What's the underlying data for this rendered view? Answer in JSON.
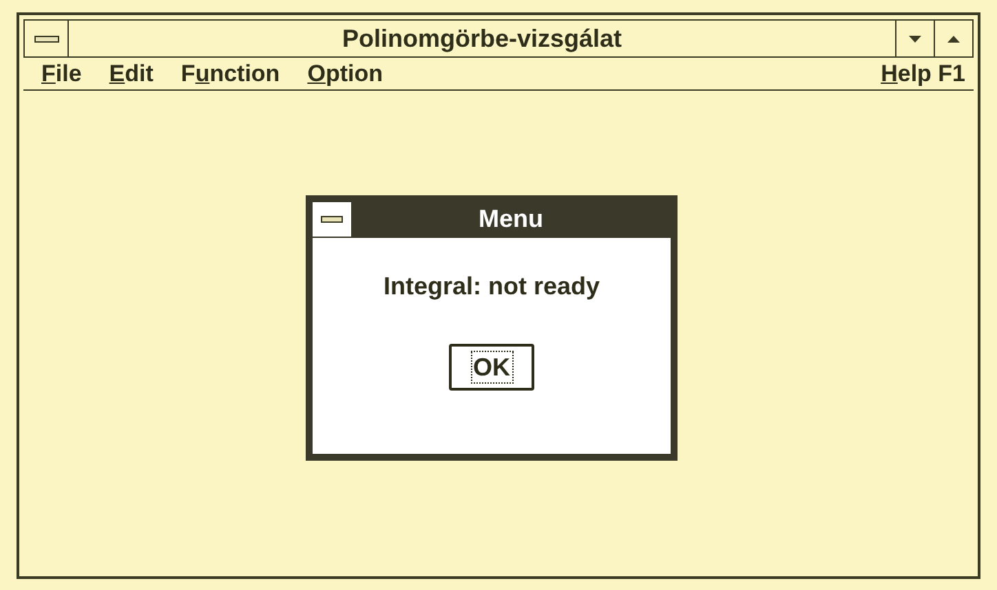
{
  "window": {
    "title": "Polinomgörbe-vizsgálat"
  },
  "menu_bar": {
    "items": [
      {
        "parts": [
          {
            "text": "F",
            "underlined": true
          },
          {
            "text": "ile",
            "underlined": false
          }
        ]
      },
      {
        "parts": [
          {
            "text": "E",
            "underlined": true
          },
          {
            "text": "dit",
            "underlined": false
          }
        ]
      },
      {
        "parts": [
          {
            "text": "F",
            "underlined": false
          },
          {
            "text": "u",
            "underlined": true
          },
          {
            "text": "nction",
            "underlined": false
          }
        ]
      },
      {
        "parts": [
          {
            "text": "O",
            "underlined": true
          },
          {
            "text": "ption",
            "underlined": false
          }
        ]
      }
    ],
    "help": {
      "parts": [
        {
          "text": "H",
          "underlined": true
        },
        {
          "text": "elp F1",
          "underlined": false
        }
      ]
    }
  },
  "dialog": {
    "title": "Menu",
    "message": "Integral: not ready",
    "buttons": [
      {
        "label": "OK",
        "focused": true
      }
    ]
  }
}
